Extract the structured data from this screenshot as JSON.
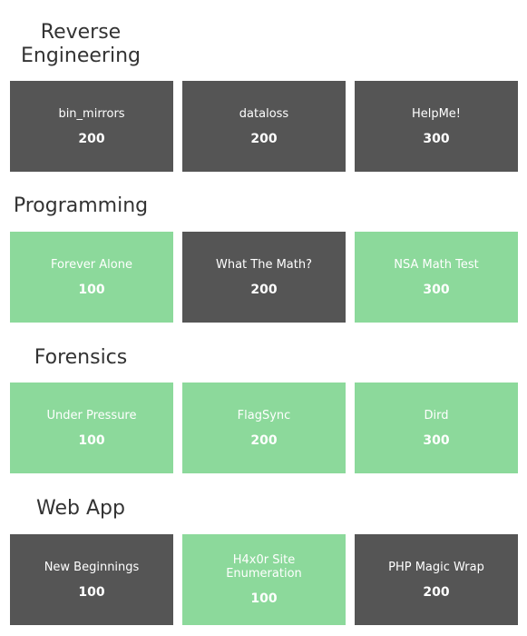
{
  "categories": [
    {
      "title": "Reverse\nEngineering",
      "challenges": [
        {
          "name": "bin_mirrors",
          "points": "200",
          "state": "locked"
        },
        {
          "name": "dataloss",
          "points": "200",
          "state": "locked"
        },
        {
          "name": "HelpMe!",
          "points": "300",
          "state": "locked"
        }
      ]
    },
    {
      "title": "Programming",
      "challenges": [
        {
          "name": "Forever Alone",
          "points": "100",
          "state": "solved"
        },
        {
          "name": "What The Math?",
          "points": "200",
          "state": "locked"
        },
        {
          "name": "NSA Math Test",
          "points": "300",
          "state": "solved"
        }
      ]
    },
    {
      "title": "Forensics",
      "challenges": [
        {
          "name": "Under Pressure",
          "points": "100",
          "state": "solved"
        },
        {
          "name": "FlagSync",
          "points": "200",
          "state": "solved"
        },
        {
          "name": "Dird",
          "points": "300",
          "state": "solved"
        }
      ]
    },
    {
      "title": "Web App",
      "challenges": [
        {
          "name": "New Beginnings",
          "points": "100",
          "state": "locked"
        },
        {
          "name": "H4x0r Site Enumeration",
          "points": "100",
          "state": "solved"
        },
        {
          "name": "PHP Magic Wrap",
          "points": "200",
          "state": "locked"
        }
      ]
    }
  ],
  "colors": {
    "locked": "#555555",
    "solved": "#8cd99b",
    "heading": "#333333"
  }
}
